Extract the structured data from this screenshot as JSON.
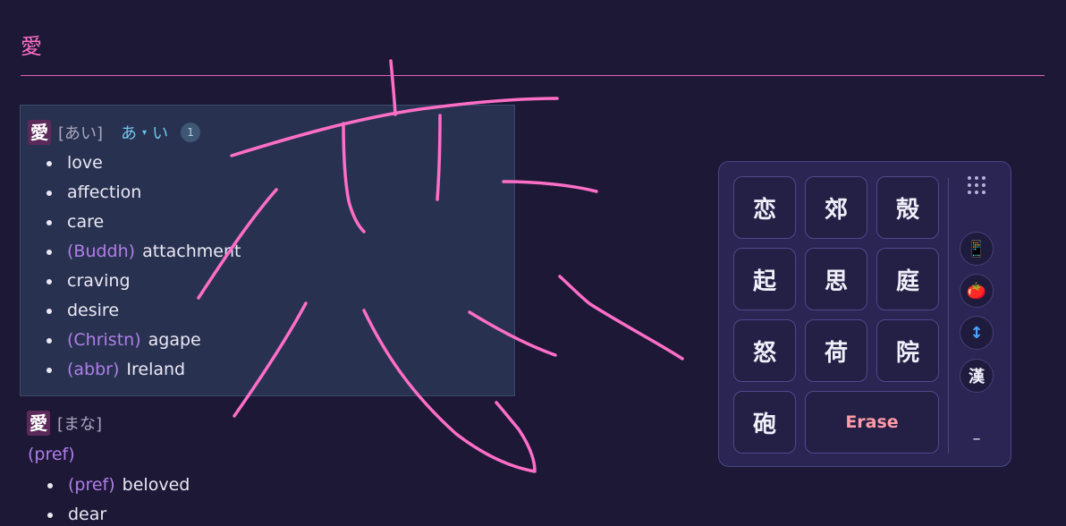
{
  "page": {
    "title": "愛"
  },
  "entries": [
    {
      "kanji": "愛",
      "reading": "[あい]",
      "pitch": {
        "mora1": "あ",
        "mora2": "い",
        "arrow": "▾"
      },
      "count": "1",
      "senses": [
        {
          "tag": "",
          "text": "love"
        },
        {
          "tag": "",
          "text": "affection"
        },
        {
          "tag": "",
          "text": "care"
        },
        {
          "tag": "(Buddh)",
          "text": "attachment"
        },
        {
          "tag": "",
          "text": "craving"
        },
        {
          "tag": "",
          "text": "desire"
        },
        {
          "tag": "(Christn)",
          "text": "agape"
        },
        {
          "tag": "(abbr)",
          "text": "Ireland"
        }
      ]
    },
    {
      "kanji": "愛",
      "reading": "[まな]",
      "pos": "(pref)",
      "senses": [
        {
          "tag": "(pref)",
          "text": "beloved"
        },
        {
          "tag": "",
          "text": "dear"
        }
      ]
    }
  ],
  "handwriting_panel": {
    "candidates": [
      "恋",
      "郊",
      "殻",
      "起",
      "思",
      "庭",
      "怒",
      "荷",
      "院",
      "砲"
    ],
    "erase_label": "Erase",
    "side_buttons": [
      {
        "name": "phone-icon",
        "glyph": "📱"
      },
      {
        "name": "tomato-icon",
        "glyph": "🍅"
      },
      {
        "name": "up-down-arrow-icon",
        "glyph": "↕"
      },
      {
        "name": "kanji-mode-button",
        "glyph": "漢"
      }
    ],
    "minimize_label": "–"
  },
  "colors": {
    "background": "#1c1836",
    "accent_pink": "#ff6ec7",
    "tag_purple": "#b07ee8",
    "pitch_blue": "#6ec8ee",
    "stroke_pink": "#ff6ec7"
  }
}
